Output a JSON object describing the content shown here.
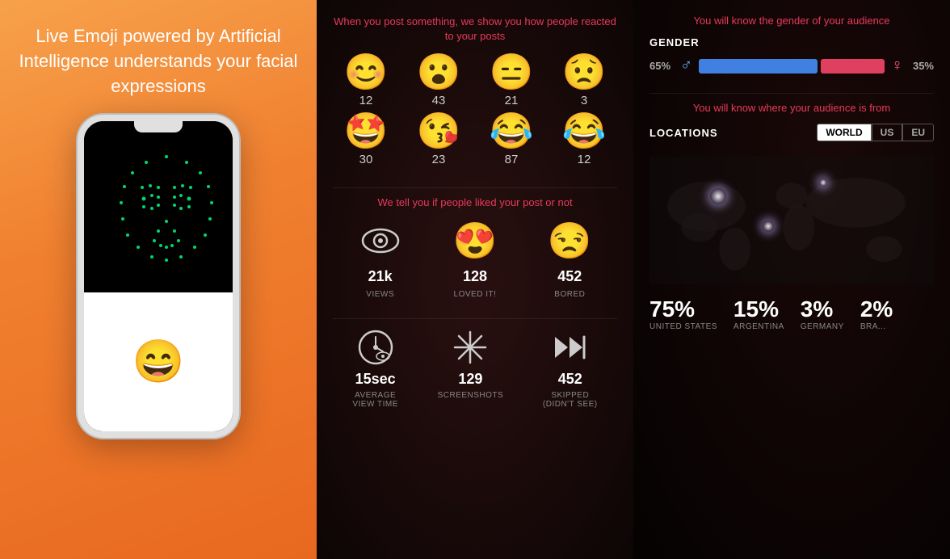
{
  "left": {
    "headline": "Live Emoji powered by Artificial Intelligence understands your facial expressions"
  },
  "middle": {
    "section1_title": "When you post something, we show you how people reacted to your posts",
    "emojis_row1": [
      {
        "emoji": "😊",
        "count": "12"
      },
      {
        "emoji": "😮",
        "count": "43"
      },
      {
        "emoji": "😐",
        "count": "21"
      },
      {
        "emoji": "😟",
        "count": "3"
      }
    ],
    "emojis_row2": [
      {
        "emoji": "🤩",
        "count": "30"
      },
      {
        "emoji": "😘",
        "count": "23"
      },
      {
        "emoji": "😂",
        "count": "87"
      },
      {
        "emoji": "😂",
        "count": "12"
      }
    ],
    "section2_title": "We tell you if people liked your post or not",
    "stats": [
      {
        "icon": "eye",
        "value": "21k",
        "label": "VIEWS"
      },
      {
        "icon": "heart-eyes",
        "emoji": "😍",
        "value": "128",
        "label": "LOVED IT!"
      },
      {
        "icon": "neutral",
        "emoji": "😑",
        "value": "452",
        "label": "BORED"
      }
    ],
    "stats2": [
      {
        "icon": "clock",
        "value": "15sec",
        "label": "AVERAGE\nVIEW TIME"
      },
      {
        "icon": "screenshot",
        "value": "129",
        "label": "SCREENSHOTS"
      },
      {
        "icon": "skip",
        "value": "452",
        "label": "SKIPPED\n(DIDN'T SEE)"
      }
    ]
  },
  "right": {
    "section1_title": "You will know the gender of your audience",
    "gender_label": "GENDER",
    "male_pct": "65%",
    "female_pct": "35%",
    "male_bar_width": 65,
    "female_bar_width": 35,
    "section2_title": "You will know where your audience is from",
    "locations_label": "LOCATIONS",
    "tabs": [
      "WORLD",
      "US",
      "EU"
    ],
    "active_tab": "WORLD",
    "countries": [
      {
        "pct": "75%",
        "name": "UNITED STATES"
      },
      {
        "pct": "15%",
        "name": "ARGENTINA"
      },
      {
        "pct": "3%",
        "name": "GERMANY"
      },
      {
        "pct": "2%",
        "name": "BRA..."
      }
    ]
  }
}
